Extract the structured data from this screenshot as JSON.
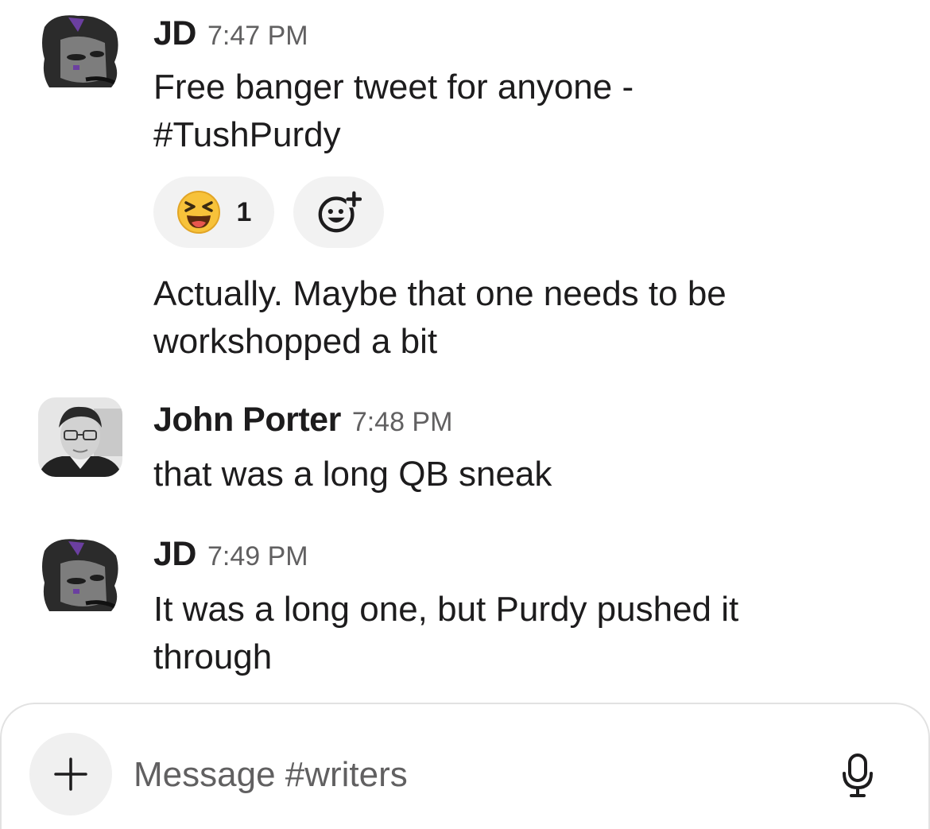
{
  "messages": [
    {
      "author": "JD",
      "time": "7:47 PM",
      "lines": [
        "Free banger tweet for anyone -",
        "#TushPurdy"
      ]
    },
    {
      "author": "JD",
      "time": "",
      "lines": [
        "Actually. Maybe that one needs to be",
        "workshopped a bit"
      ]
    },
    {
      "author": "John Porter",
      "time": "7:48 PM",
      "lines": [
        "that was a long QB sneak"
      ]
    },
    {
      "author": "JD",
      "time": "7:49 PM",
      "lines": [
        "It was a long one, but Purdy pushed it",
        "through"
      ]
    }
  ],
  "reactions": [
    {
      "emoji": "laughing-squinting-face-icon",
      "count": "1"
    }
  ],
  "add_reaction_icon": "add-emoji-icon",
  "composer": {
    "placeholder": "Message #writers",
    "plus_icon": "plus-icon",
    "mic_icon": "microphone-icon"
  },
  "colors": {
    "text": "#1d1c1d",
    "muted": "#616061",
    "reaction_bg": "#f2f2f2",
    "accent_avatar": "#6b3fa0",
    "emoji_yellow": "#f7c23a"
  }
}
